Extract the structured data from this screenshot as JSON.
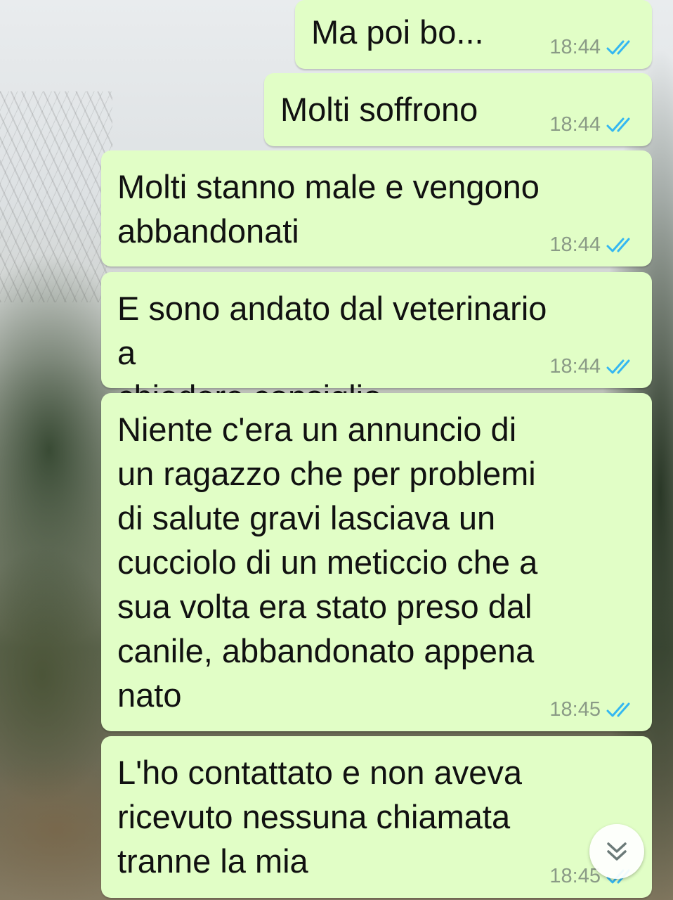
{
  "colors": {
    "outgoing_bubble": "#e1fec6",
    "message_text": "#111111",
    "timestamp": "#8a9a86",
    "read_ticks": "#34b7f1"
  },
  "messages": [
    {
      "text": "Ma poi bo...",
      "time": "18:44",
      "status_icon": "double-check-read-icon"
    },
    {
      "text": "Molti soffrono",
      "time": "18:44",
      "status_icon": "double-check-read-icon"
    },
    {
      "text": "Molti stanno male e vengono\nabbandonati",
      "time": "18:44",
      "status_icon": "double-check-read-icon"
    },
    {
      "text": "E sono andato dal veterinario a\nchiedere consiglio",
      "time": "18:44",
      "status_icon": "double-check-read-icon"
    },
    {
      "text": "Niente c'era un annuncio di\nun ragazzo che per problemi\ndi salute gravi lasciava un\ncucciolo di un meticcio che a\nsua volta era stato preso dal\ncanile, abbandonato appena\nnato",
      "time": "18:45",
      "status_icon": "double-check-read-icon"
    },
    {
      "text": "L'ho contattato e non aveva\nricevuto nessuna chiamata\ntranne la mia",
      "time": "18:45",
      "status_icon": "double-check-read-icon"
    }
  ],
  "scroll_button": {
    "icon": "chevron-double-down-icon"
  }
}
